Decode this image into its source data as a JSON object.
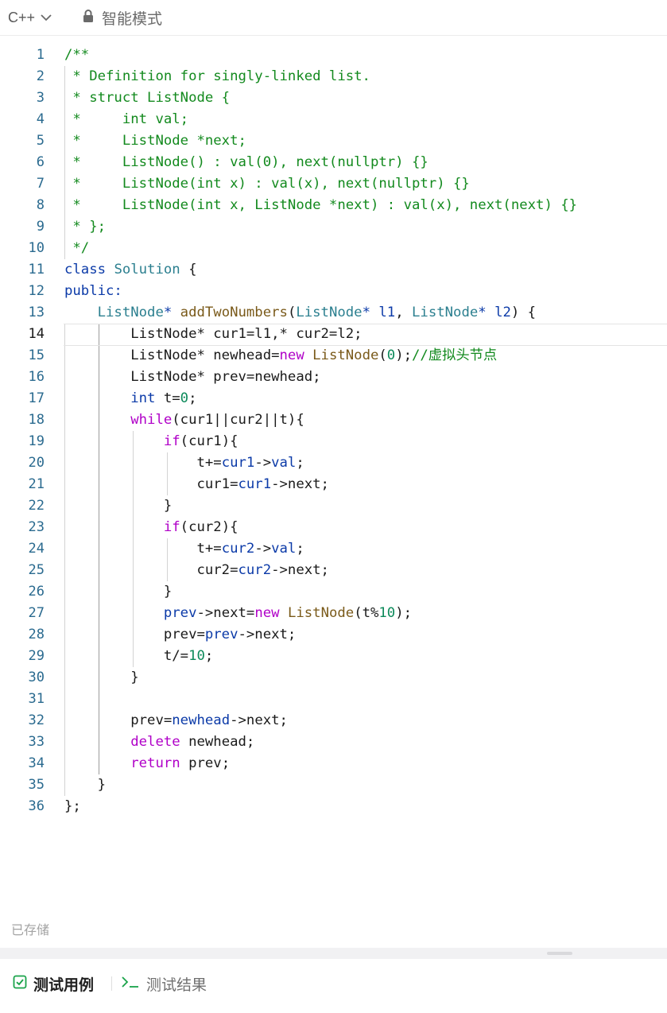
{
  "toolbar": {
    "language": "C++",
    "mode": "智能模式"
  },
  "colors": {
    "comment": "#138a1e",
    "keyword": "#0b3aa8",
    "control": "#b000c8",
    "type": "#2b7f8f",
    "function": "#7a5a1a",
    "number": "#0c8a5a",
    "line_number": "#2a6a8f",
    "accent_green": "#1aa34a"
  },
  "editor": {
    "active_line": 14,
    "lines": [
      {
        "n": "1",
        "tokens": [
          [
            "c",
            "/**"
          ]
        ]
      },
      {
        "n": "2",
        "tokens": [
          [
            "c",
            " * Definition for singly-linked list."
          ]
        ]
      },
      {
        "n": "3",
        "tokens": [
          [
            "c",
            " * struct ListNode {"
          ]
        ]
      },
      {
        "n": "4",
        "tokens": [
          [
            "c",
            " *     int val;"
          ]
        ]
      },
      {
        "n": "5",
        "tokens": [
          [
            "c",
            " *     ListNode *next;"
          ]
        ]
      },
      {
        "n": "6",
        "tokens": [
          [
            "c",
            " *     ListNode() : val(0), next(nullptr) {}"
          ]
        ]
      },
      {
        "n": "7",
        "tokens": [
          [
            "c",
            " *     ListNode(int x) : val(x), next(nullptr) {}"
          ]
        ]
      },
      {
        "n": "8",
        "tokens": [
          [
            "c",
            " *     ListNode(int x, ListNode *next) : val(x), next(next) {}"
          ]
        ]
      },
      {
        "n": "9",
        "tokens": [
          [
            "c",
            " * };"
          ]
        ]
      },
      {
        "n": "10",
        "tokens": [
          [
            "c",
            " */"
          ]
        ]
      },
      {
        "n": "11",
        "tokens": [
          [
            "k",
            "class"
          ],
          [
            "p",
            " "
          ],
          [
            "t",
            "Solution"
          ],
          [
            "p",
            " {"
          ]
        ]
      },
      {
        "n": "12",
        "tokens": [
          [
            "k",
            "public:"
          ]
        ]
      },
      {
        "n": "13",
        "tokens": [
          [
            "p",
            "    "
          ],
          [
            "t",
            "ListNode"
          ],
          [
            "k",
            "*"
          ],
          [
            "p",
            " "
          ],
          [
            "f",
            "addTwoNumbers"
          ],
          [
            "p",
            "("
          ],
          [
            "t",
            "ListNode"
          ],
          [
            "k",
            "*"
          ],
          [
            "p",
            " "
          ],
          [
            "v",
            "l1"
          ],
          [
            "p",
            ", "
          ],
          [
            "t",
            "ListNode"
          ],
          [
            "k",
            "*"
          ],
          [
            "p",
            " "
          ],
          [
            "v",
            "l2"
          ],
          [
            "p",
            ") {"
          ]
        ]
      },
      {
        "n": "14",
        "tokens": [
          [
            "p",
            "        ListNode* cur1=l1,* cur2=l2;"
          ]
        ]
      },
      {
        "n": "15",
        "tokens": [
          [
            "p",
            "        ListNode* newhead="
          ],
          [
            "kp",
            "new"
          ],
          [
            "p",
            " "
          ],
          [
            "f",
            "ListNode"
          ],
          [
            "p",
            "("
          ],
          [
            "n",
            "0"
          ],
          [
            "p",
            ");"
          ],
          [
            "c",
            "//虚拟头节点"
          ]
        ]
      },
      {
        "n": "16",
        "tokens": [
          [
            "p",
            "        ListNode* prev=newhead;"
          ]
        ]
      },
      {
        "n": "17",
        "tokens": [
          [
            "p",
            "        "
          ],
          [
            "k",
            "int"
          ],
          [
            "p",
            " t="
          ],
          [
            "n",
            "0"
          ],
          [
            "p",
            ";"
          ]
        ]
      },
      {
        "n": "18",
        "tokens": [
          [
            "p",
            "        "
          ],
          [
            "kp",
            "while"
          ],
          [
            "p",
            "(cur1||cur2||t){"
          ]
        ]
      },
      {
        "n": "19",
        "tokens": [
          [
            "p",
            "            "
          ],
          [
            "kp",
            "if"
          ],
          [
            "p",
            "(cur1){"
          ]
        ]
      },
      {
        "n": "20",
        "tokens": [
          [
            "p",
            "                t+="
          ],
          [
            "k",
            "cur1"
          ],
          [
            "p",
            "->"
          ],
          [
            "k",
            "val"
          ],
          [
            "p",
            ";"
          ]
        ]
      },
      {
        "n": "21",
        "tokens": [
          [
            "p",
            "                cur1="
          ],
          [
            "k",
            "cur1"
          ],
          [
            "p",
            "->next;"
          ]
        ]
      },
      {
        "n": "22",
        "tokens": [
          [
            "p",
            "            }"
          ]
        ]
      },
      {
        "n": "23",
        "tokens": [
          [
            "p",
            "            "
          ],
          [
            "kp",
            "if"
          ],
          [
            "p",
            "(cur2){"
          ]
        ]
      },
      {
        "n": "24",
        "tokens": [
          [
            "p",
            "                t+="
          ],
          [
            "k",
            "cur2"
          ],
          [
            "p",
            "->"
          ],
          [
            "k",
            "val"
          ],
          [
            "p",
            ";"
          ]
        ]
      },
      {
        "n": "25",
        "tokens": [
          [
            "p",
            "                cur2="
          ],
          [
            "k",
            "cur2"
          ],
          [
            "p",
            "->next;"
          ]
        ]
      },
      {
        "n": "26",
        "tokens": [
          [
            "p",
            "            }"
          ]
        ]
      },
      {
        "n": "27",
        "tokens": [
          [
            "p",
            "            "
          ],
          [
            "k",
            "prev"
          ],
          [
            "p",
            "->next="
          ],
          [
            "kp",
            "new"
          ],
          [
            "p",
            " "
          ],
          [
            "f",
            "ListNode"
          ],
          [
            "p",
            "(t%"
          ],
          [
            "n",
            "10"
          ],
          [
            "p",
            ");"
          ]
        ]
      },
      {
        "n": "28",
        "tokens": [
          [
            "p",
            "            prev="
          ],
          [
            "k",
            "prev"
          ],
          [
            "p",
            "->next;"
          ]
        ]
      },
      {
        "n": "29",
        "tokens": [
          [
            "p",
            "            t/="
          ],
          [
            "n",
            "10"
          ],
          [
            "p",
            ";"
          ]
        ]
      },
      {
        "n": "30",
        "tokens": [
          [
            "p",
            "        }"
          ]
        ]
      },
      {
        "n": "31",
        "tokens": []
      },
      {
        "n": "32",
        "tokens": [
          [
            "p",
            "        prev="
          ],
          [
            "k",
            "newhead"
          ],
          [
            "p",
            "->next;"
          ]
        ]
      },
      {
        "n": "33",
        "tokens": [
          [
            "p",
            "        "
          ],
          [
            "kp",
            "delete"
          ],
          [
            "p",
            " newhead;"
          ]
        ]
      },
      {
        "n": "34",
        "tokens": [
          [
            "p",
            "        "
          ],
          [
            "kp",
            "return"
          ],
          [
            "p",
            " prev;"
          ]
        ]
      },
      {
        "n": "35",
        "tokens": [
          [
            "p",
            "    }"
          ]
        ]
      },
      {
        "n": "36",
        "tokens": [
          [
            "p",
            "};"
          ]
        ]
      }
    ]
  },
  "status": {
    "saved": "已存储"
  },
  "bottom_tabs": {
    "test_cases": "测试用例",
    "test_results": "测试结果"
  }
}
